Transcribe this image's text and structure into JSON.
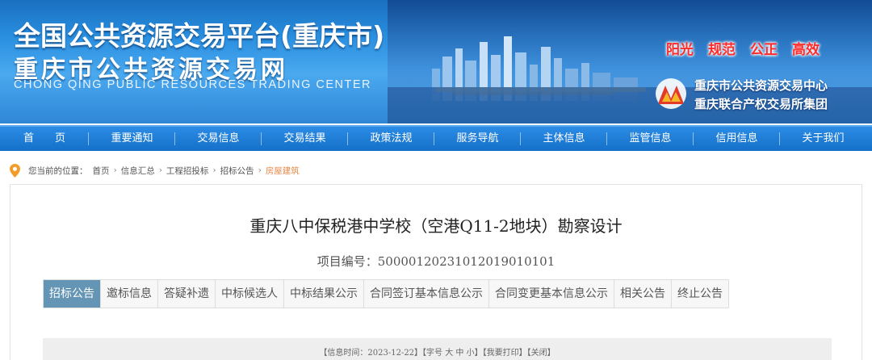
{
  "banner": {
    "title_line1": "全国公共资源交易平台(重庆市)",
    "title_line2": "重庆市公共资源交易网",
    "title_en": "CHONG QING PUBLIC RESOURCES TRADING CENTER",
    "slogans": [
      "阳光",
      "规范",
      "公正",
      "高效"
    ],
    "center_line1": "重庆市公共资源交易中心",
    "center_line2": "重庆联合产权交易所集团"
  },
  "nav": {
    "items": [
      "首　　页",
      "重要通知",
      "交易信息",
      "交易结果",
      "政策法规",
      "服务导航",
      "主体信息",
      "监管信息",
      "信用信息",
      "关于我们"
    ]
  },
  "breadcrumb": {
    "prefix": "您当前的位置：",
    "items": [
      "首页",
      "信息汇总",
      "工程招投标",
      "招标公告"
    ],
    "current": "房屋建筑",
    "separator": "›"
  },
  "article": {
    "title": "重庆八中保税港中学校（空港Q11-2地块）勘察设计",
    "project_no_label": "项目编号：",
    "project_no": "500001202310120190 10101"
  },
  "tabs": {
    "items": [
      "招标公告",
      "邀标信息",
      "答疑补遗",
      "中标候选人",
      "中标结果公示",
      "合同签订基本信息公示",
      "合同变更基本信息公示",
      "相关公告",
      "终止公告"
    ],
    "active_index": 0
  },
  "infobar": {
    "info_time": "【信息时间：2023-12-22】",
    "font_size_label": "【字号",
    "size_large": "大",
    "size_medium": "中",
    "size_small": "小】",
    "print": "【我要打印】",
    "close": "【关闭】"
  },
  "colors": {
    "nav_bg": "#1f7fd8",
    "tab_active": "#6495b5",
    "slogan": "#ff2a2a",
    "breadcrumb_current": "#e68a4b"
  },
  "icons": {
    "location": "map-pin-icon",
    "logo": "trading-center-logo-icon"
  }
}
